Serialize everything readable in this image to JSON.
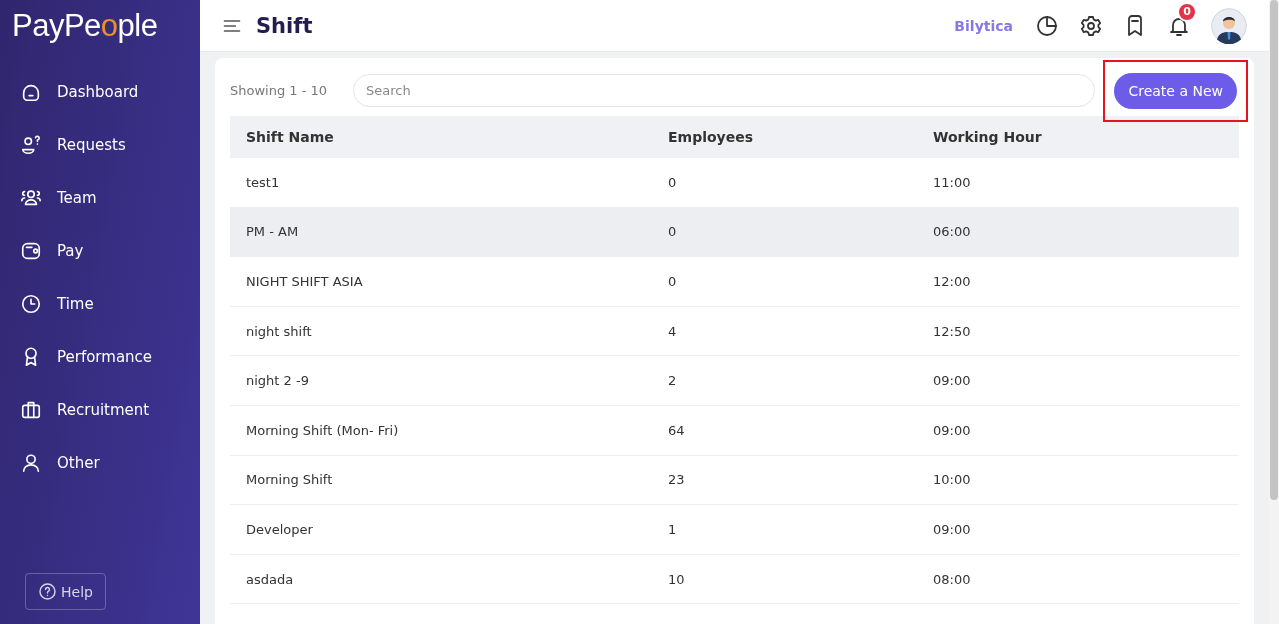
{
  "logo": [
    {
      "text": "PayPe",
      "accent": false
    },
    {
      "text": "o",
      "accent": true
    },
    {
      "text": "ple"
    }
  ],
  "sidebar": {
    "items": [
      {
        "label": "Dashboard",
        "kind": "home",
        "selected": false
      },
      {
        "label": "Requests",
        "kind": "request",
        "selected": false
      },
      {
        "label": "Team",
        "kind": "team",
        "selected": false
      },
      {
        "label": "Pay",
        "kind": "wallet",
        "selected": false
      },
      {
        "label": "Time",
        "kind": "clock",
        "selected": false
      },
      {
        "label": "Performance",
        "kind": "award",
        "selected": false
      },
      {
        "label": "Recruitment",
        "kind": "briefcase",
        "selected": false
      },
      {
        "label": "Other",
        "kind": "person",
        "selected": false
      }
    ],
    "help": "Help"
  },
  "header": {
    "title": "Shift",
    "company": "Bilytica",
    "notifications": "0"
  },
  "toolbar": {
    "showing": "Showing 1 - 10",
    "search": {
      "placeholder": "Search"
    },
    "create_button": "Create a New",
    "create_highlighted": true
  },
  "table": {
    "columns": [
      "Shift Name",
      "Employees",
      "Working Hour"
    ],
    "rows": [
      {
        "cells": [
          "test1",
          "0",
          "11:00"
        ],
        "selected": false
      },
      {
        "cells": [
          "PM - AM",
          "0",
          "06:00"
        ],
        "selected": true
      },
      {
        "cells": [
          "NIGHT SHIFT ASIA",
          "0",
          "12:00"
        ],
        "selected": false
      },
      {
        "cells": [
          "night shift",
          "4",
          "12:50"
        ],
        "selected": false
      },
      {
        "cells": [
          "night 2 -9",
          "2",
          "09:00"
        ],
        "selected": false
      },
      {
        "cells": [
          "Morning Shift (Mon- Fri)",
          "64",
          "09:00"
        ],
        "selected": false
      },
      {
        "cells": [
          "Morning Shift",
          "23",
          "10:00"
        ],
        "selected": false
      },
      {
        "cells": [
          "Developer",
          "1",
          "09:00"
        ],
        "selected": false
      },
      {
        "cells": [
          "asdada",
          "10",
          "08:00"
        ],
        "selected": false
      }
    ]
  }
}
